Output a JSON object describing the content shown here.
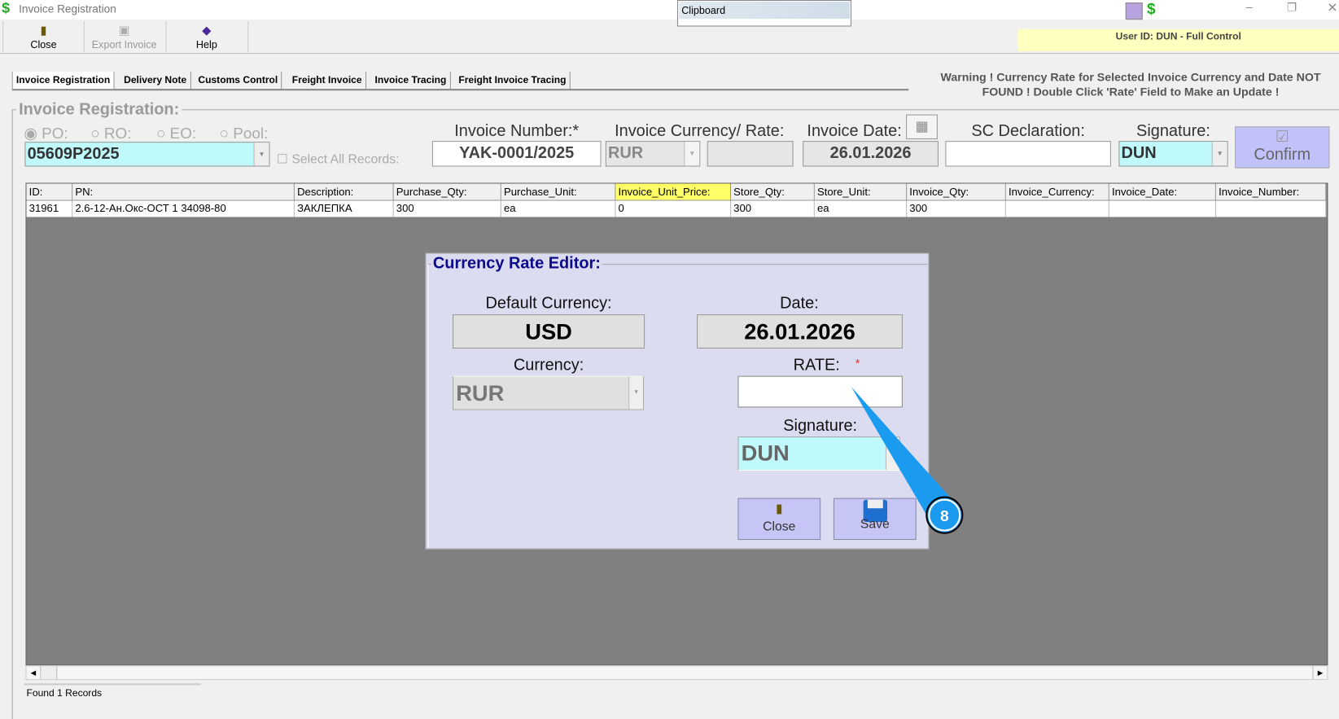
{
  "window": {
    "title": "Invoice Registration",
    "clipboard_label": "Clipboard",
    "user_info": "User ID: DUN - Full Control"
  },
  "toolbar": {
    "close": "Close",
    "export": "Export Invoice",
    "help": "Help"
  },
  "tabs": [
    "Invoice Registration",
    "Delivery Note",
    "Customs Control",
    "Freight Invoice",
    "Invoice Tracing",
    "Freight Invoice Tracing"
  ],
  "warning": "Warning ! Currency Rate for Selected Invoice Currency and Date NOT FOUND ! Double Click 'Rate' Field to Make an Update !",
  "form": {
    "group_title": "Invoice Registration:",
    "radios": [
      "PO:",
      "RO:",
      "EO:",
      "Pool:"
    ],
    "order_value": "05609P2025",
    "select_all_label": "Select All Records:",
    "invoice_number_label": "Invoice Number:*",
    "invoice_number": "YAK-0001/2025",
    "currency_rate_label": "Invoice Currency/ Rate:",
    "currency": "RUR",
    "rate": "",
    "invoice_date_label": "Invoice Date:",
    "invoice_date": "26.01.2026",
    "sc_label": "SC Declaration:",
    "sc_value": "",
    "signature_label": "Signature:",
    "signature": "DUN",
    "confirm": "Confirm"
  },
  "table": {
    "columns": [
      "ID:",
      "PN:",
      "Description:",
      "Purchase_Qty:",
      "Purchase_Unit:",
      "Invoice_Unit_Price:",
      "Store_Qty:",
      "Store_Unit:",
      "Invoice_Qty:",
      "Invoice_Currency:",
      "Invoice_Date:",
      "Invoice_Number:"
    ],
    "rows": [
      [
        "31961",
        "2.6-12-Ан.Окс-ОСТ 1 34098-80",
        "ЗАКЛЕПКА",
        "300",
        "ea",
        "0",
        "300",
        "ea",
        "300",
        "",
        "",
        ""
      ]
    ]
  },
  "dialog": {
    "title": "Currency Rate Editor:",
    "default_currency_label": "Default Currency:",
    "default_currency": "USD",
    "date_label": "Date:",
    "date": "26.01.2026",
    "currency_label": "Currency:",
    "currency": "RUR",
    "rate_label": "RATE:",
    "rate_required": "*",
    "rate": "",
    "signature_label": "Signature:",
    "signature": "DUN",
    "close": "Close",
    "save": "Save"
  },
  "callout": {
    "number": "8",
    "color": "#1a9bf0"
  },
  "status": "Found 1 Records"
}
